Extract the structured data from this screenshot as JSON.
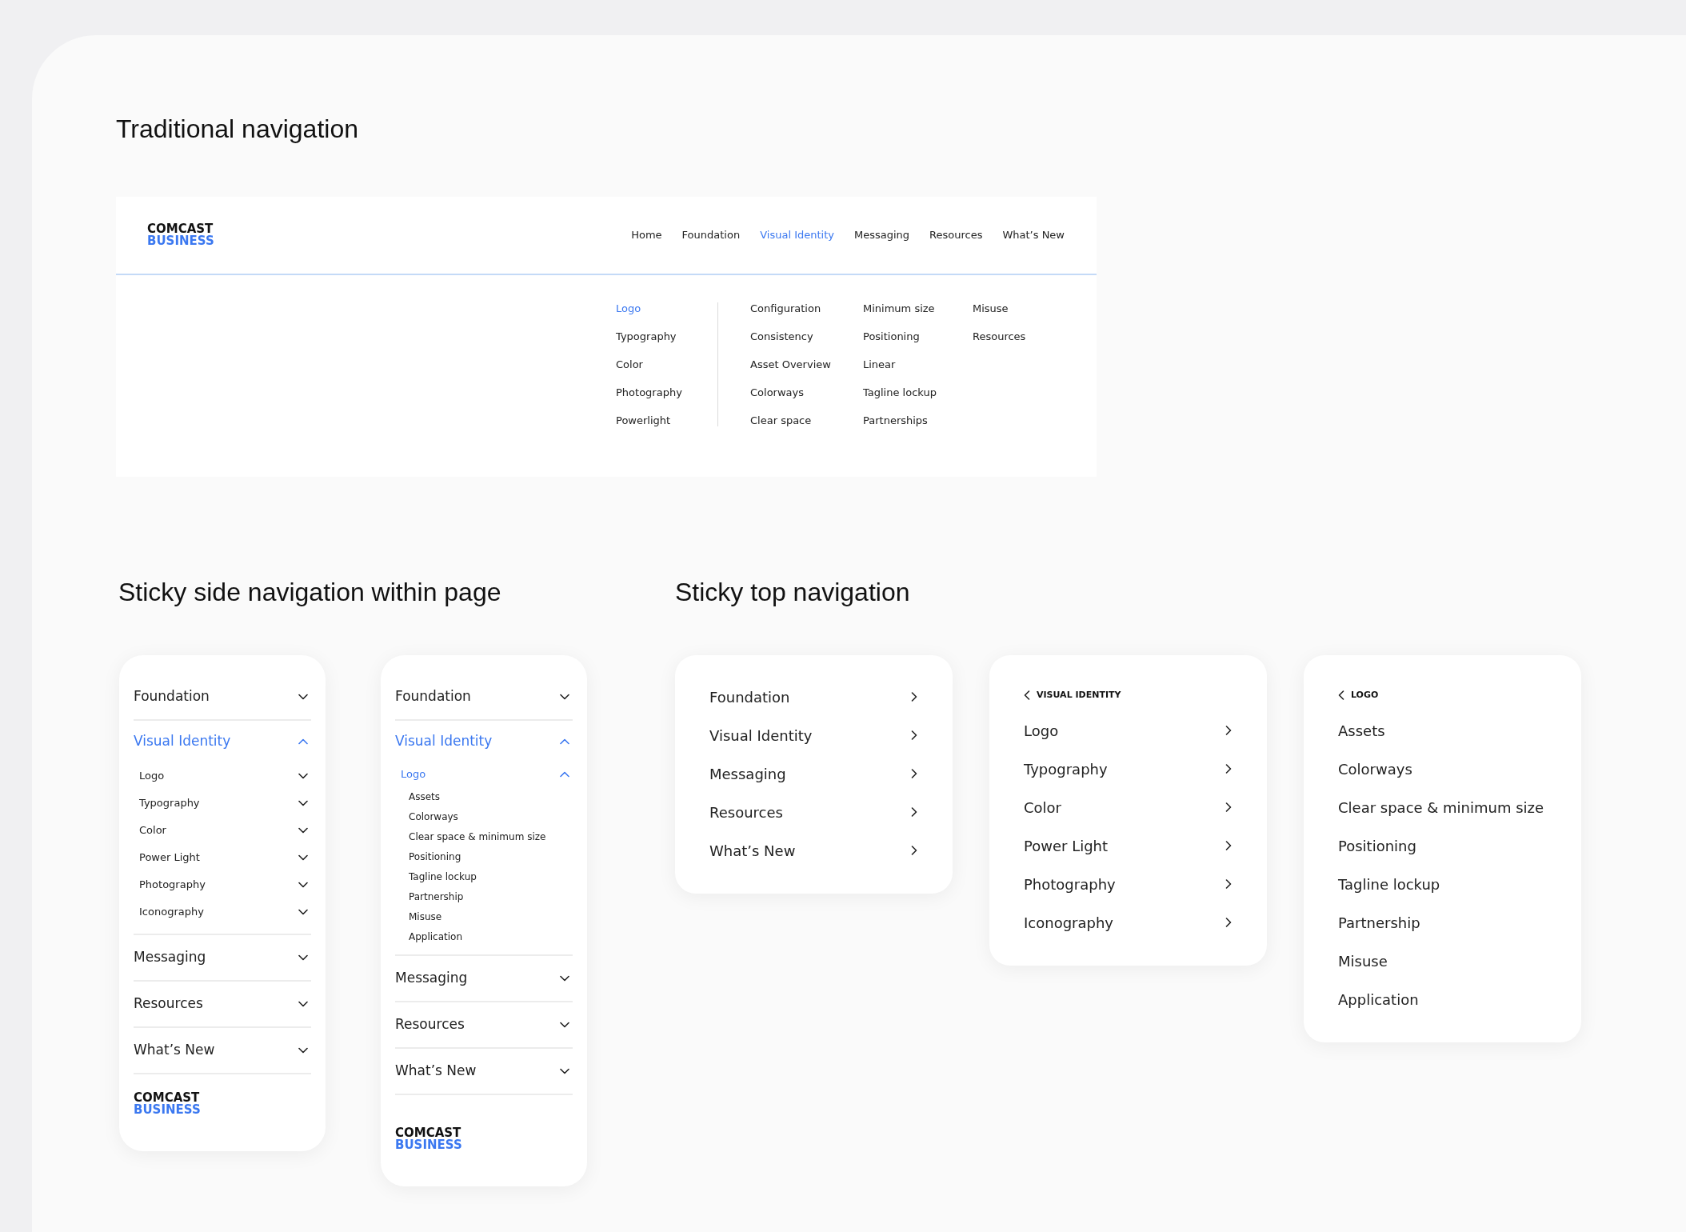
{
  "traditional": {
    "title": "Traditional navigation",
    "logo": {
      "line1": "COMCAST",
      "line2": "BUSINESS"
    },
    "menu": [
      {
        "label": "Home",
        "selected": false
      },
      {
        "label": "Foundation",
        "selected": false
      },
      {
        "label": "Visual Identity",
        "selected": true
      },
      {
        "label": "Messaging",
        "selected": false
      },
      {
        "label": "Resources",
        "selected": false
      },
      {
        "label": "What’s New",
        "selected": false
      }
    ],
    "dropdown": {
      "primary": [
        {
          "label": "Logo",
          "selected": true
        },
        {
          "label": "Typography",
          "selected": false
        },
        {
          "label": "Color",
          "selected": false
        },
        {
          "label": "Photography",
          "selected": false
        },
        {
          "label": "Powerlight",
          "selected": false
        }
      ],
      "columns": [
        [
          "Configuration",
          "Consistency",
          "Asset Overview",
          "Colorways",
          "Clear space"
        ],
        [
          "Minimum size",
          "Positioning",
          "Linear",
          "Tagline lockup",
          "Partnerships"
        ],
        [
          "Misuse",
          "Resources"
        ]
      ]
    }
  },
  "side": {
    "title": "Sticky side navigation within page",
    "panels": [
      {
        "items": [
          {
            "label": "Foundation",
            "expanded": false
          },
          {
            "label": "Visual Identity",
            "expanded": true,
            "children": [
              {
                "label": "Logo",
                "expanded": false
              },
              {
                "label": "Typography",
                "expanded": false
              },
              {
                "label": "Color",
                "expanded": false
              },
              {
                "label": "Power Light",
                "expanded": false
              },
              {
                "label": "Photography",
                "expanded": false
              },
              {
                "label": "Iconography",
                "expanded": false
              }
            ]
          },
          {
            "label": "Messaging",
            "expanded": false
          },
          {
            "label": "Resources",
            "expanded": false
          },
          {
            "label": "What’s New",
            "expanded": false
          }
        ],
        "logo": {
          "line1": "COMCAST",
          "line2": "BUSINESS"
        }
      },
      {
        "items": [
          {
            "label": "Foundation",
            "expanded": false
          },
          {
            "label": "Visual Identity",
            "expanded": true,
            "children": [
              {
                "label": "Logo",
                "expanded": true,
                "children": [
                  "Assets",
                  "Colorways",
                  "Clear space & minimum size",
                  "Positioning",
                  "Tagline lockup",
                  "Partnership",
                  "Misuse",
                  "Application"
                ]
              }
            ]
          },
          {
            "label": "Messaging",
            "expanded": false
          },
          {
            "label": "Resources",
            "expanded": false
          },
          {
            "label": "What’s New",
            "expanded": false
          }
        ],
        "logo": {
          "line1": "COMCAST",
          "line2": "BUSINESS"
        }
      }
    ]
  },
  "top": {
    "title": "Sticky top navigation",
    "panels": [
      {
        "items": [
          {
            "label": "Foundation",
            "kind": "submenu"
          },
          {
            "label": "Visual Identity",
            "kind": "submenu"
          },
          {
            "label": "Messaging",
            "kind": "submenu"
          },
          {
            "label": "Resources",
            "kind": "submenu"
          },
          {
            "label": "What’s New",
            "kind": "submenu"
          }
        ]
      },
      {
        "back": "VISUAL IDENTITY",
        "items": [
          {
            "label": "Logo",
            "kind": "submenu"
          },
          {
            "label": "Typography",
            "kind": "submenu"
          },
          {
            "label": "Color",
            "kind": "submenu"
          },
          {
            "label": "Power Light",
            "kind": "submenu"
          },
          {
            "label": "Photography",
            "kind": "submenu"
          },
          {
            "label": "Iconography",
            "kind": "submenu"
          }
        ]
      },
      {
        "back": "LOGO",
        "items": [
          {
            "label": "Assets",
            "kind": "page"
          },
          {
            "label": "Colorways",
            "kind": "page"
          },
          {
            "label": "Clear space & minimum size",
            "kind": "page"
          },
          {
            "label": "Positioning",
            "kind": "page"
          },
          {
            "label": "Tagline lockup",
            "kind": "page"
          },
          {
            "label": "Partnership",
            "kind": "page"
          },
          {
            "label": "Misuse",
            "kind": "page"
          },
          {
            "label": "Application",
            "kind": "page"
          }
        ]
      }
    ]
  }
}
